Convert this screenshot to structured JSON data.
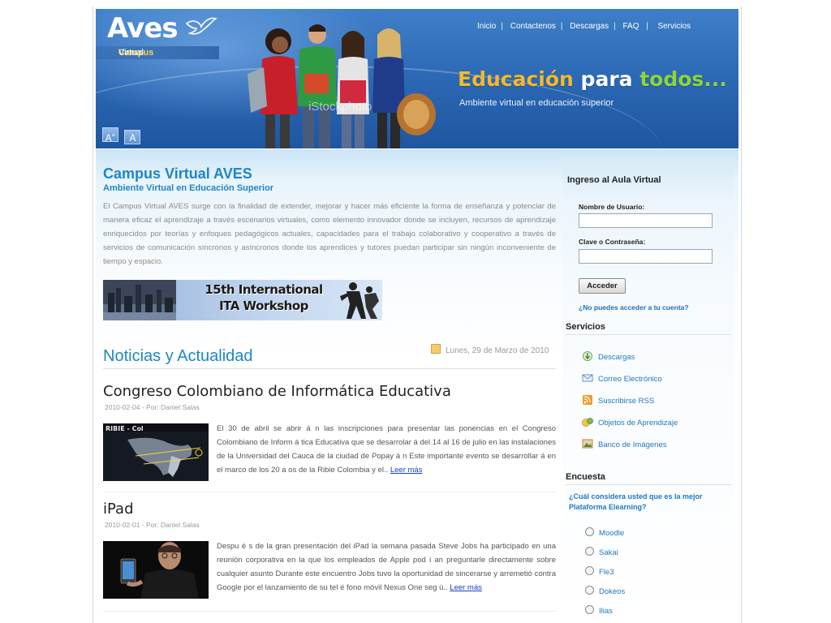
{
  "header": {
    "logo": "Aves",
    "logo_sub_1": "Campus",
    "logo_sub_2": "Virtual",
    "watermark": "iStockphoto",
    "nav": [
      "Inicio",
      "Contactenos",
      "Descargas",
      "FAQ",
      "Servicios"
    ],
    "slogan_1": "Educación",
    "slogan_2": "para",
    "slogan_3": "todos...",
    "slogan_sub": "Ambiente virtual en educación superior",
    "font_increase": "A",
    "font_increase_sup": "+",
    "font_decrease": "A"
  },
  "main": {
    "title": "Campus Virtual AVES",
    "subtitle": "Ambiente Virtual en Educación Superior",
    "intro": "El Campus Virtual AVES surge con la finalidad de extender, mejorar y hacer más eficiente la forma de enseñanza y potenciar de manera eficaz el aprendizaje a través escenarios virtuales, como elemento innovador donde se incluyen, recursos de aprendizaje enriquecidos por teorías y enfoques pedagógicos actuales, capacidades para el trabajo colaborativo y cooperativo a través de servicios de comunicación síncronos y asíncronos donde los aprendices y tutores puedan participar sin ningún inconveniente de tiempo y espacio.",
    "banner_line1": "15th International",
    "banner_line2": "ITA Workshop",
    "news_heading": "Noticias y Actualidad",
    "news_date": "Lunes, 29 de Marzo de 2010",
    "articles": [
      {
        "title": "Congreso Colombiano de Informática Educativa",
        "meta": "2010-02-04 - Por: Daniel Salas",
        "thumb_caption": "RIBIE - Col",
        "text": "El 30 de abril  se abrir á n  las inscripciones para  presentar las ponencias   en el Congreso Colombiano de Inform á tica Educativa que se desarrolar á del 14 al 16 de julio en las instalaciones de la Universidad del Cauca de la ciudad de Popay á n Este importante evento se desarrollar á en el marco de los 20 a os de la Ribie Colombia y el.. ",
        "more": "Leer más"
      },
      {
        "title": "iPad",
        "meta": "2010-02-01 - Por: Daniel Salas",
        "text": "Despu é s de la gran presentación del iPad la semana pasada Steve Jobs ha participado en una reunión corporativa en la que los empleados de Apple pod í an preguntarle directamente sobre cualquier asunto Durante este encuentro Jobs tuvo la oportunidad de sincerarse y arremetió contra Google por el lanzamiento de su tel é fono móvil Nexus One seg ú.. ",
        "more": "Leer más"
      }
    ]
  },
  "sidebar": {
    "login_title": "Ingreso al Aula Virtual",
    "username_label": "Nombre de Usuario:",
    "password_label": "Clave o Contraseña:",
    "username_value": "",
    "password_value": "",
    "submit": "Acceder",
    "forgot": "¿No puedes acceder a tu cuenta?",
    "services_title": "Servicios",
    "services": [
      {
        "label": "Descargas",
        "icon": "download-icon"
      },
      {
        "label": "Correo Electrónico",
        "icon": "mail-icon"
      },
      {
        "label": "Suscribirse RSS",
        "icon": "rss-icon"
      },
      {
        "label": "Objetos de Aprendizaje",
        "icon": "learning-objects-icon"
      },
      {
        "label": "Banco de Imágenes",
        "icon": "image-bank-icon"
      }
    ],
    "poll_title": "Encuesta",
    "poll_question": "¿Cuál considera usted que es la mejor Plataforma Elearning?",
    "poll_options": [
      "Moodle",
      "Sakai",
      "Fle3",
      "Dokeos",
      "Ilias"
    ]
  },
  "colors": {
    "header_blue": "#2a66b2",
    "accent_blue": "#1f86c6",
    "link_blue": "#1f78c0",
    "slogan_orange": "#f4b82c",
    "slogan_green": "#8ed43a"
  }
}
